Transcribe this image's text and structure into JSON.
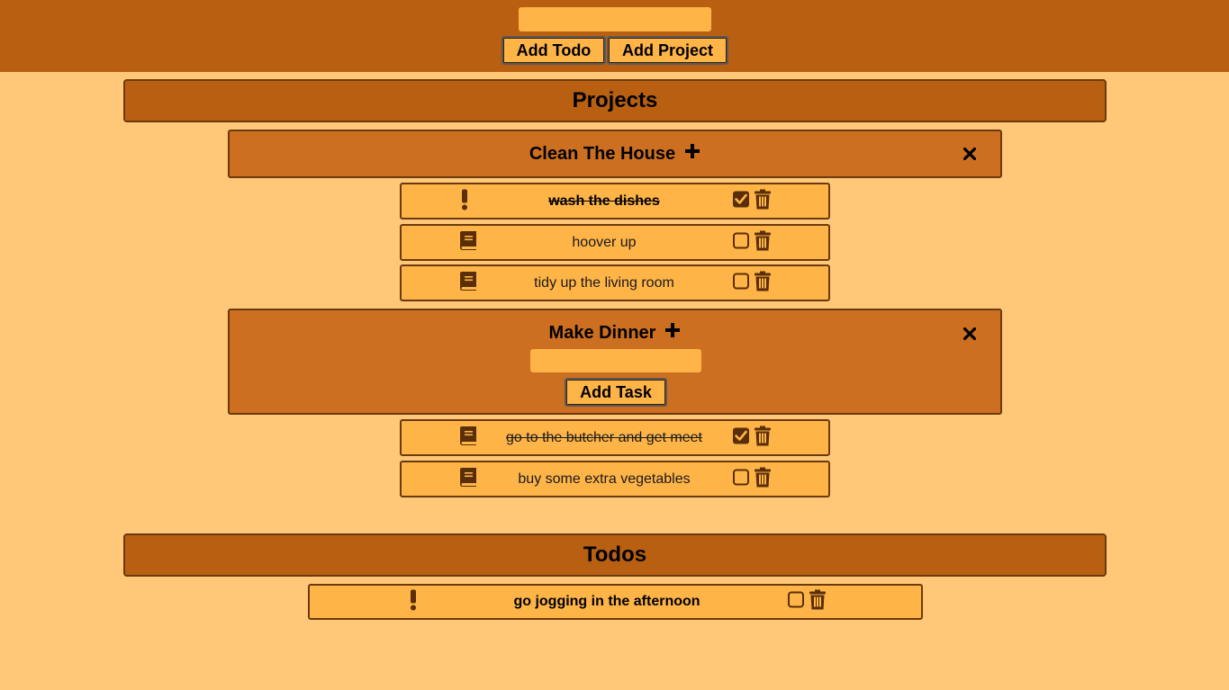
{
  "header": {
    "input_value": "",
    "add_todo_label": "Add Todo",
    "add_project_label": "Add Project"
  },
  "projects_section": {
    "title": "Projects",
    "projects": [
      {
        "title": "Clean The House",
        "expanded": false,
        "tasks": [
          {
            "text": "wash the dishes",
            "type": "priority",
            "done": true,
            "bold": true
          },
          {
            "text": "hoover up",
            "type": "note",
            "done": false,
            "bold": false
          },
          {
            "text": "tidy up the living room",
            "type": "note",
            "done": false,
            "bold": false
          }
        ]
      },
      {
        "title": "Make Dinner",
        "expanded": true,
        "task_input_value": "",
        "add_task_label": "Add Task",
        "tasks": [
          {
            "text": "go to the butcher and get meet",
            "type": "note",
            "done": true,
            "bold": false
          },
          {
            "text": "buy some extra vegetables",
            "type": "note",
            "done": false,
            "bold": false
          }
        ]
      }
    ]
  },
  "todos_section": {
    "title": "Todos",
    "todos": [
      {
        "text": "go jogging in the afternoon",
        "type": "priority",
        "done": false,
        "bold": true
      }
    ]
  },
  "colors": {
    "background": "#ffc878",
    "header": "#b85f12",
    "project": "#cd6f20",
    "item": "#ffb448",
    "icon": "#5a2e08"
  }
}
